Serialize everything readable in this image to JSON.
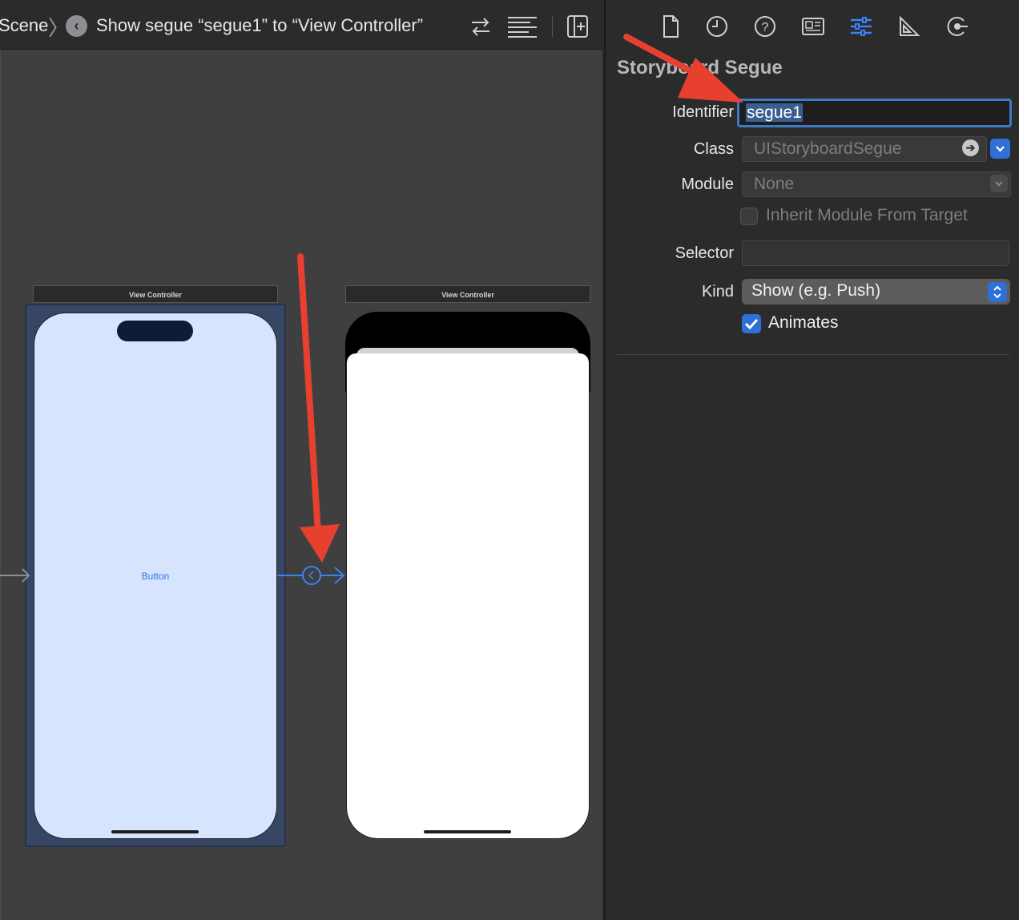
{
  "jumpbar": {
    "scene_crumb": "Scene",
    "separator": "〉",
    "segue_icon": "‹",
    "segue_crumb": "Show segue “segue1” to “View Controller”",
    "icons": [
      "swap-arrows-icon",
      "editor-options-icon",
      "add-editor-icon"
    ]
  },
  "canvas": {
    "scene1_title": "View Controller",
    "scene2_title": "View Controller",
    "button_label": "Button"
  },
  "inspector": {
    "tabs": [
      "file-icon",
      "history-icon",
      "help-icon",
      "identity-icon",
      "attributes-icon",
      "size-icon",
      "connections-icon"
    ],
    "active_tab": "attributes-icon",
    "section_title": "Storyboard Segue",
    "identifier_label": "Identifier",
    "identifier_value": "segue1",
    "class_label": "Class",
    "class_placeholder": "UIStoryboardSegue",
    "module_label": "Module",
    "module_placeholder": "None",
    "inherit_label": "Inherit Module From Target",
    "selector_label": "Selector",
    "selector_value": "",
    "kind_label": "Kind",
    "kind_value": "Show (e.g. Push)",
    "animates_label": "Animates",
    "animates_checked": true
  },
  "colors": {
    "accent": "#2f6fd6",
    "annotation_red": "#e8402f",
    "segue_blue": "#3b82f6"
  }
}
